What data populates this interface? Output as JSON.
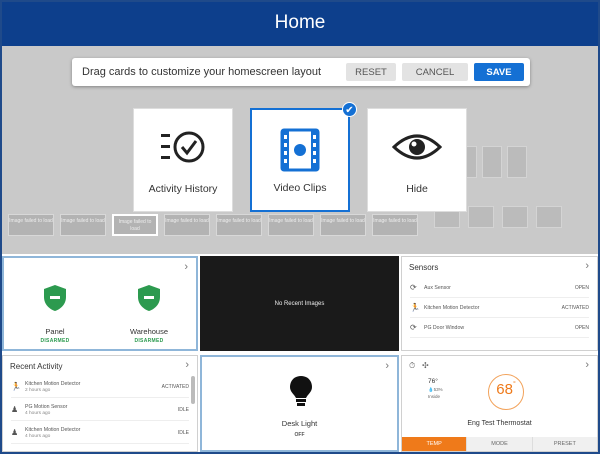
{
  "header": {
    "title": "Home"
  },
  "toolbar": {
    "message": "Drag cards to customize your homescreen layout",
    "reset_label": "RESET",
    "cancel_label": "CANCEL",
    "save_label": "SAVE"
  },
  "cards": [
    {
      "label": "Activity History"
    },
    {
      "label": "Video Clips"
    },
    {
      "label": "Hide"
    }
  ],
  "background_tiles": [
    "Image failed to load",
    "Image failed to load",
    "Image failed to load",
    "Image failed to load",
    "Image failed to load",
    "Image failed to load",
    "Image failed to load",
    "Image failed to load"
  ],
  "security": {
    "items": [
      {
        "name": "Panel",
        "status": "DISARMED"
      },
      {
        "name": "Warehouse",
        "status": "DISARMED"
      }
    ]
  },
  "camera": {
    "empty_text": "No Recent Images"
  },
  "sensors": {
    "title": "Sensors",
    "items": [
      {
        "name": "Aux Sensor",
        "status": "OPEN"
      },
      {
        "name": "Kitchen Motion Detector",
        "status": "ACTIVATED"
      },
      {
        "name": "PG Door Window",
        "status": "OPEN"
      }
    ]
  },
  "activity": {
    "title": "Recent Activity",
    "items": [
      {
        "name": "Kitchen Motion Detector",
        "time": "2 hours ago",
        "status": "ACTIVATED"
      },
      {
        "name": "PG Motion Sensor",
        "time": "4 hours ago",
        "status": "IDLE"
      },
      {
        "name": "Kitchen Motion Detector",
        "time": "4 hours ago",
        "status": "IDLE"
      }
    ]
  },
  "light": {
    "name": "Desk Light",
    "status": "OFF"
  },
  "thermostat": {
    "name": "Eng Test Thermostat",
    "indoor_temp": "76°",
    "humidity": "53%",
    "location": "Inside",
    "setpoint": "68",
    "degree": "°",
    "tabs": [
      "TEMP",
      "MODE",
      "PRESET"
    ]
  },
  "colors": {
    "header": "#0d3f8c",
    "accent": "#1470d4",
    "armed_green": "#2c9a4f",
    "thermo_orange": "#ef7a1a"
  }
}
